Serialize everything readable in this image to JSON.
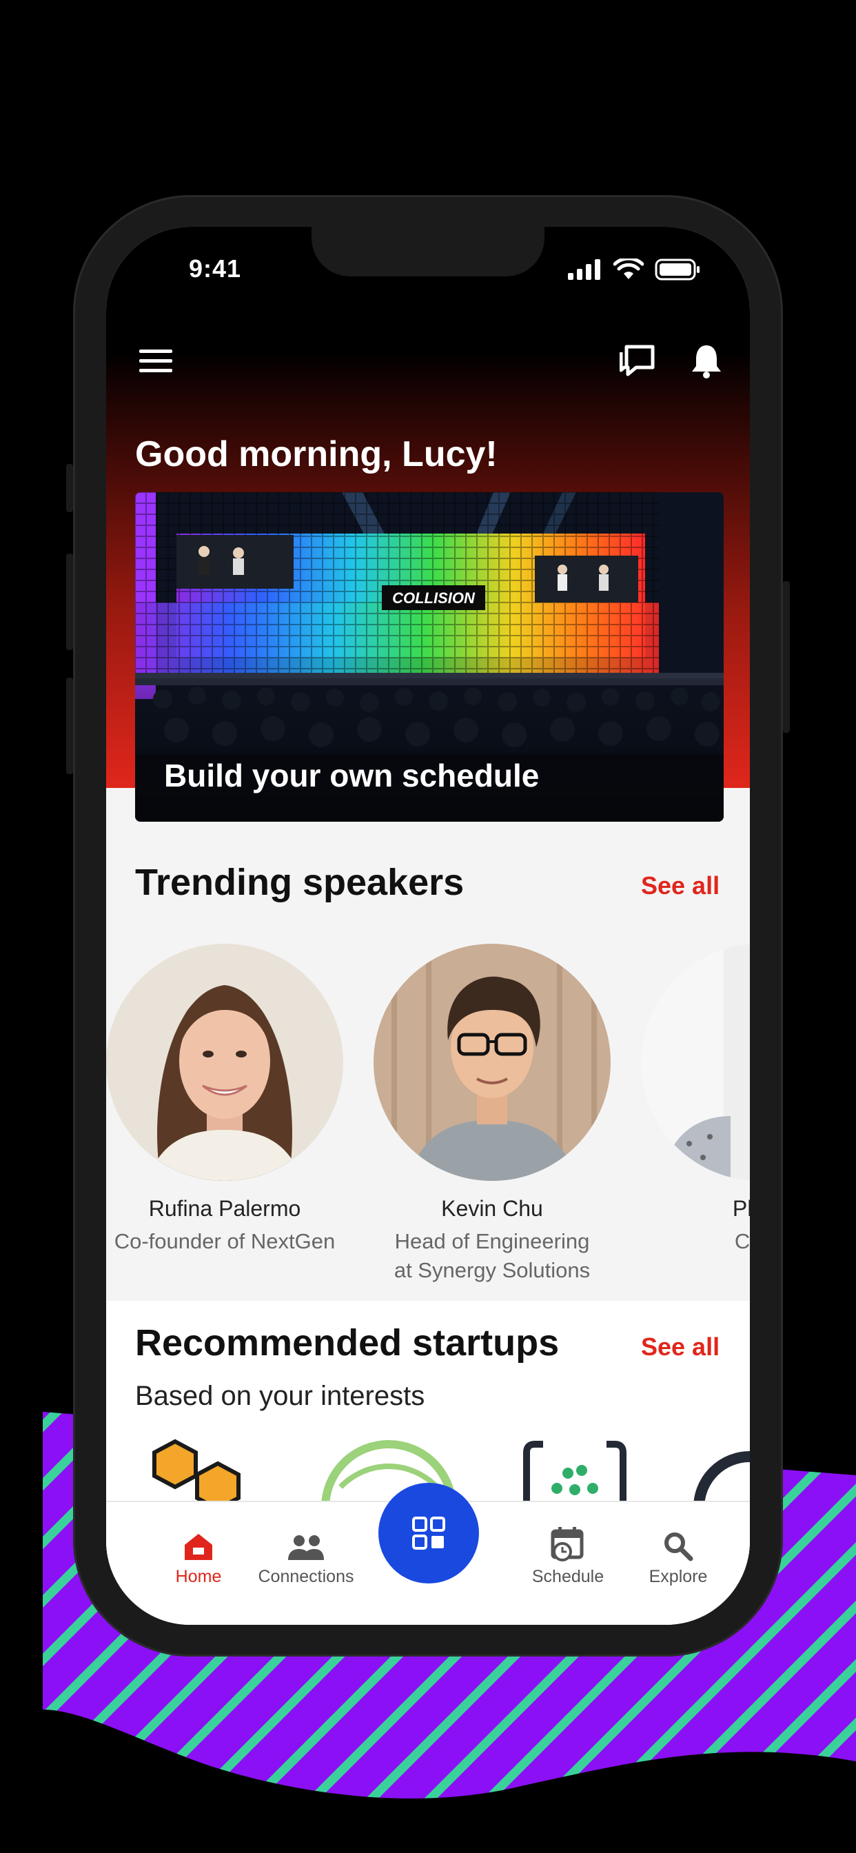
{
  "status_bar": {
    "time": "9:41"
  },
  "header": {
    "greeting": "Good morning, Lucy!"
  },
  "hero": {
    "title": "Build your own schedule",
    "stage_sign": "COLLISION"
  },
  "speakers": {
    "title": "Trending speakers",
    "see_all": "See all",
    "items": [
      {
        "name": "Rufina Palermo",
        "role": "Co-founder of NextGen"
      },
      {
        "name": "Kevin Chu",
        "role_line1": "Head of Engineering",
        "role_line2": "at Synergy Solutions"
      },
      {
        "name": "Philip",
        "role": "CMO"
      }
    ]
  },
  "startups": {
    "title": "Recommended startups",
    "see_all": "See all",
    "subtitle": "Based on your interests"
  },
  "tabbar": {
    "home": "Home",
    "connections": "Connections",
    "schedule": "Schedule",
    "explore": "Explore"
  },
  "colors": {
    "accent": "#e0261c",
    "fab": "#1a49e0",
    "ribbon": "#8b10f5",
    "stripe": "#3ad29a"
  }
}
